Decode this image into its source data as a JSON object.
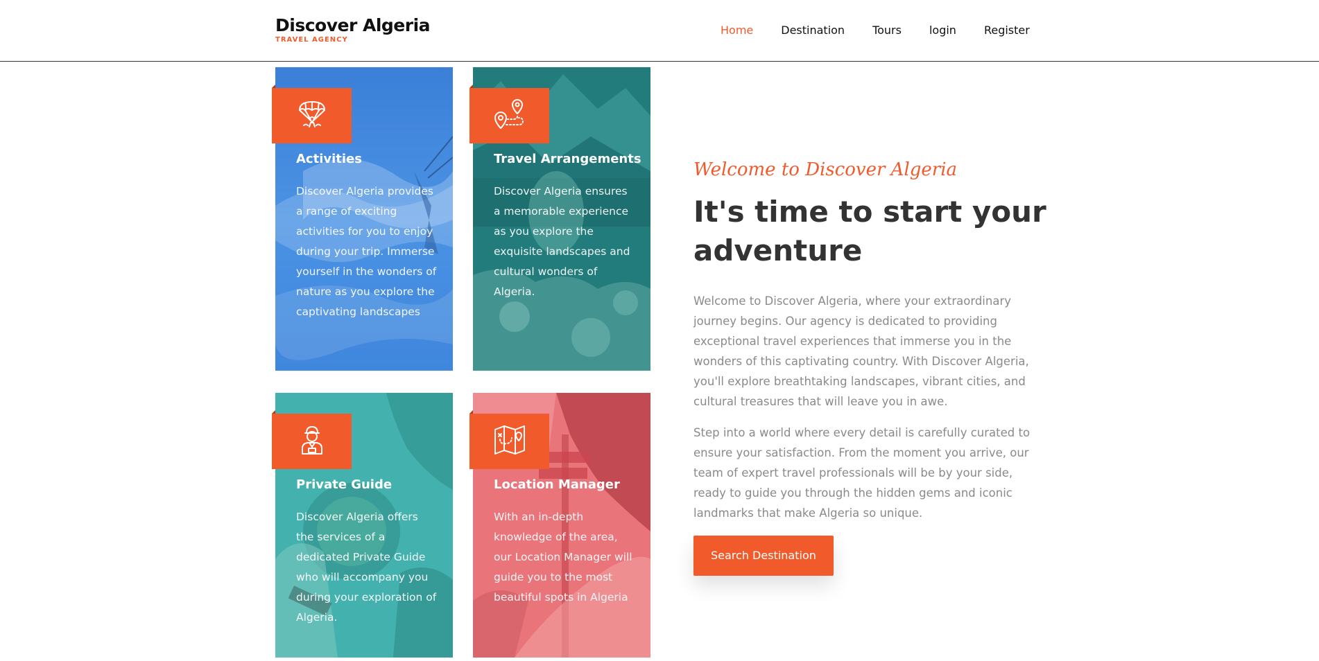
{
  "header": {
    "brand_title": "Discover Algeria",
    "brand_subtitle": "TRAVEL AGENCY",
    "nav": [
      "Home",
      "Destination",
      "Tours",
      "login",
      "Register"
    ],
    "active_nav": "Home"
  },
  "cards": [
    {
      "title": "Activities",
      "text": "Discover Algeria provides a range of exciting activities for you to enjoy during your trip. Immerse yourself in the wonders of nature as you explore the captivating landscapes",
      "icon": "parachute-icon",
      "overlay_color": "#3d8be0"
    },
    {
      "title": "Travel Arrangements",
      "text": "Discover Algeria ensures a memorable experience as you explore the exquisite landscapes and cultural wonders of Algeria.",
      "icon": "route-map-pin-icon",
      "overlay_color": "#1e7f80"
    },
    {
      "title": "Private Guide",
      "text": "Discover Algeria offers the services of a dedicated Private Guide who will accompany you during your exploration of Algeria.",
      "icon": "tour-guide-icon",
      "overlay_color": "#3fb0ad"
    },
    {
      "title": "Location Manager",
      "text": "With an in-depth knowledge of the area, our Location Manager will guide you to the most beautiful spots in Algeria",
      "icon": "folded-map-icon",
      "overlay_color": "#e05a60"
    }
  ],
  "hero": {
    "welcome": "Welcome to Discover Algeria",
    "headline": "It's time to start your adventure",
    "paragraph_1": "Welcome to Discover Algeria, where your extraordinary journey begins. Our agency is dedicated to providing exceptional travel experiences that immerse you in the wonders of this captivating country. With Discover Algeria, you'll explore breathtaking landscapes, vibrant cities, and cultural treasures that will leave you in awe.",
    "paragraph_2": "Step into a world where every detail is carefully curated to ensure your satisfaction. From the moment you arrive, our team of expert travel professionals will be by your side, ready to guide you through the hidden gems and iconic landmarks that make Algeria so unique.",
    "cta_label": "Search Destination"
  },
  "colors": {
    "accent": "#f15a2b",
    "heading": "#333333",
    "body_text": "#8a8a8a"
  }
}
